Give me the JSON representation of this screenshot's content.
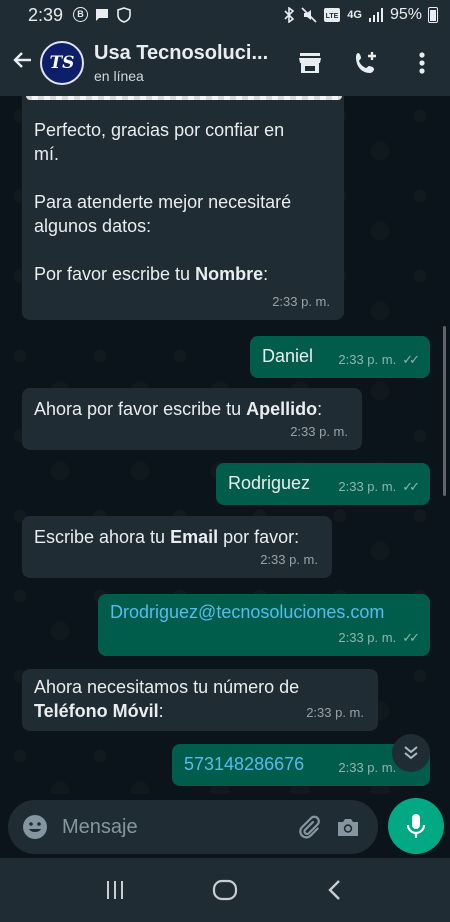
{
  "status_bar": {
    "time": "2:39",
    "battery": "95%",
    "network": "4G"
  },
  "header": {
    "avatar_text": "TS",
    "title": "Usa Tecnosoluci...",
    "subtitle": "en línea"
  },
  "messages": [
    {
      "dir": "in",
      "text": "Perfecto, gracias por confiar en\nmí.\n\nPara atenderte mejor necesitaré\nalgunos datos:\n\nPor favor escribe tu ",
      "bold": "Nombre",
      "suffix": ":",
      "time": "2:33 p. m."
    },
    {
      "dir": "out",
      "text": "Daniel",
      "time": "2:33 p. m."
    },
    {
      "dir": "in",
      "text": "Ahora por favor escribe tu ",
      "bold": "Apellido",
      "suffix": ":",
      "time": "2:33 p. m."
    },
    {
      "dir": "out",
      "text": "Rodriguez",
      "time": "2:33 p. m."
    },
    {
      "dir": "in",
      "text": "Escribe ahora tu ",
      "bold": "Email",
      "suffix": " por favor:",
      "time": "2:33 p. m."
    },
    {
      "dir": "out",
      "text": "Drodriguez@tecnosoluciones.com",
      "time": "2:33 p. m."
    },
    {
      "dir": "in",
      "text": "Ahora necesitamos tu número de\n",
      "bold": "Teléfono Móvil",
      "suffix": ":",
      "time": "2:33 p. m."
    },
    {
      "dir": "out",
      "text": "573148286676",
      "time": "2:33 p. m."
    }
  ],
  "input": {
    "placeholder": "Mensaje"
  },
  "colors": {
    "incoming": "#1f2c34",
    "outgoing": "#005c4b",
    "accent": "#00a884",
    "link": "#53bdeb"
  }
}
